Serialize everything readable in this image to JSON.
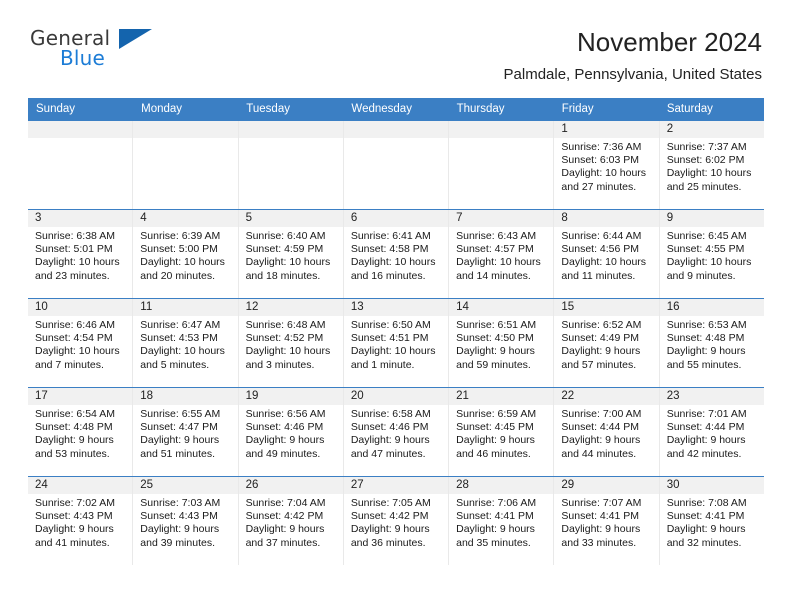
{
  "brand": {
    "name_part1": "General",
    "name_part2": "Blue",
    "accent_color": "#1c7cd6",
    "triangle_color": "#1464ad"
  },
  "header": {
    "title": "November 2024",
    "subtitle": "Palmdale, Pennsylvania, United States"
  },
  "calendar": {
    "header_bg": "#3b7fc4",
    "weekdays": [
      "Sunday",
      "Monday",
      "Tuesday",
      "Wednesday",
      "Thursday",
      "Friday",
      "Saturday"
    ],
    "weeks": [
      [
        {
          "day": "",
          "empty": true
        },
        {
          "day": "",
          "empty": true
        },
        {
          "day": "",
          "empty": true
        },
        {
          "day": "",
          "empty": true
        },
        {
          "day": "",
          "empty": true
        },
        {
          "day": "1",
          "sunrise": "Sunrise: 7:36 AM",
          "sunset": "Sunset: 6:03 PM",
          "daylight": "Daylight: 10 hours and 27 minutes."
        },
        {
          "day": "2",
          "sunrise": "Sunrise: 7:37 AM",
          "sunset": "Sunset: 6:02 PM",
          "daylight": "Daylight: 10 hours and 25 minutes."
        }
      ],
      [
        {
          "day": "3",
          "sunrise": "Sunrise: 6:38 AM",
          "sunset": "Sunset: 5:01 PM",
          "daylight": "Daylight: 10 hours and 23 minutes."
        },
        {
          "day": "4",
          "sunrise": "Sunrise: 6:39 AM",
          "sunset": "Sunset: 5:00 PM",
          "daylight": "Daylight: 10 hours and 20 minutes."
        },
        {
          "day": "5",
          "sunrise": "Sunrise: 6:40 AM",
          "sunset": "Sunset: 4:59 PM",
          "daylight": "Daylight: 10 hours and 18 minutes."
        },
        {
          "day": "6",
          "sunrise": "Sunrise: 6:41 AM",
          "sunset": "Sunset: 4:58 PM",
          "daylight": "Daylight: 10 hours and 16 minutes."
        },
        {
          "day": "7",
          "sunrise": "Sunrise: 6:43 AM",
          "sunset": "Sunset: 4:57 PM",
          "daylight": "Daylight: 10 hours and 14 minutes."
        },
        {
          "day": "8",
          "sunrise": "Sunrise: 6:44 AM",
          "sunset": "Sunset: 4:56 PM",
          "daylight": "Daylight: 10 hours and 11 minutes."
        },
        {
          "day": "9",
          "sunrise": "Sunrise: 6:45 AM",
          "sunset": "Sunset: 4:55 PM",
          "daylight": "Daylight: 10 hours and 9 minutes."
        }
      ],
      [
        {
          "day": "10",
          "sunrise": "Sunrise: 6:46 AM",
          "sunset": "Sunset: 4:54 PM",
          "daylight": "Daylight: 10 hours and 7 minutes."
        },
        {
          "day": "11",
          "sunrise": "Sunrise: 6:47 AM",
          "sunset": "Sunset: 4:53 PM",
          "daylight": "Daylight: 10 hours and 5 minutes."
        },
        {
          "day": "12",
          "sunrise": "Sunrise: 6:48 AM",
          "sunset": "Sunset: 4:52 PM",
          "daylight": "Daylight: 10 hours and 3 minutes."
        },
        {
          "day": "13",
          "sunrise": "Sunrise: 6:50 AM",
          "sunset": "Sunset: 4:51 PM",
          "daylight": "Daylight: 10 hours and 1 minute."
        },
        {
          "day": "14",
          "sunrise": "Sunrise: 6:51 AM",
          "sunset": "Sunset: 4:50 PM",
          "daylight": "Daylight: 9 hours and 59 minutes."
        },
        {
          "day": "15",
          "sunrise": "Sunrise: 6:52 AM",
          "sunset": "Sunset: 4:49 PM",
          "daylight": "Daylight: 9 hours and 57 minutes."
        },
        {
          "day": "16",
          "sunrise": "Sunrise: 6:53 AM",
          "sunset": "Sunset: 4:48 PM",
          "daylight": "Daylight: 9 hours and 55 minutes."
        }
      ],
      [
        {
          "day": "17",
          "sunrise": "Sunrise: 6:54 AM",
          "sunset": "Sunset: 4:48 PM",
          "daylight": "Daylight: 9 hours and 53 minutes."
        },
        {
          "day": "18",
          "sunrise": "Sunrise: 6:55 AM",
          "sunset": "Sunset: 4:47 PM",
          "daylight": "Daylight: 9 hours and 51 minutes."
        },
        {
          "day": "19",
          "sunrise": "Sunrise: 6:56 AM",
          "sunset": "Sunset: 4:46 PM",
          "daylight": "Daylight: 9 hours and 49 minutes."
        },
        {
          "day": "20",
          "sunrise": "Sunrise: 6:58 AM",
          "sunset": "Sunset: 4:46 PM",
          "daylight": "Daylight: 9 hours and 47 minutes."
        },
        {
          "day": "21",
          "sunrise": "Sunrise: 6:59 AM",
          "sunset": "Sunset: 4:45 PM",
          "daylight": "Daylight: 9 hours and 46 minutes."
        },
        {
          "day": "22",
          "sunrise": "Sunrise: 7:00 AM",
          "sunset": "Sunset: 4:44 PM",
          "daylight": "Daylight: 9 hours and 44 minutes."
        },
        {
          "day": "23",
          "sunrise": "Sunrise: 7:01 AM",
          "sunset": "Sunset: 4:44 PM",
          "daylight": "Daylight: 9 hours and 42 minutes."
        }
      ],
      [
        {
          "day": "24",
          "sunrise": "Sunrise: 7:02 AM",
          "sunset": "Sunset: 4:43 PM",
          "daylight": "Daylight: 9 hours and 41 minutes."
        },
        {
          "day": "25",
          "sunrise": "Sunrise: 7:03 AM",
          "sunset": "Sunset: 4:43 PM",
          "daylight": "Daylight: 9 hours and 39 minutes."
        },
        {
          "day": "26",
          "sunrise": "Sunrise: 7:04 AM",
          "sunset": "Sunset: 4:42 PM",
          "daylight": "Daylight: 9 hours and 37 minutes."
        },
        {
          "day": "27",
          "sunrise": "Sunrise: 7:05 AM",
          "sunset": "Sunset: 4:42 PM",
          "daylight": "Daylight: 9 hours and 36 minutes."
        },
        {
          "day": "28",
          "sunrise": "Sunrise: 7:06 AM",
          "sunset": "Sunset: 4:41 PM",
          "daylight": "Daylight: 9 hours and 35 minutes."
        },
        {
          "day": "29",
          "sunrise": "Sunrise: 7:07 AM",
          "sunset": "Sunset: 4:41 PM",
          "daylight": "Daylight: 9 hours and 33 minutes."
        },
        {
          "day": "30",
          "sunrise": "Sunrise: 7:08 AM",
          "sunset": "Sunset: 4:41 PM",
          "daylight": "Daylight: 9 hours and 32 minutes."
        }
      ]
    ]
  }
}
